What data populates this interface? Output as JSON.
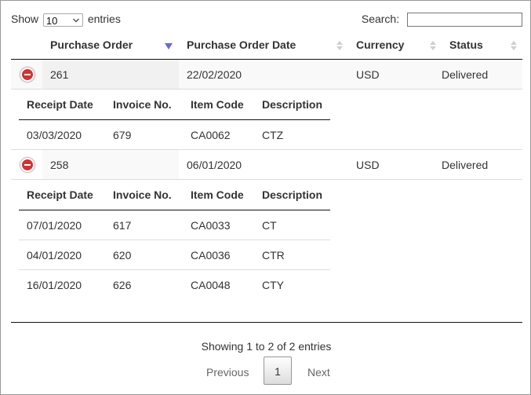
{
  "length": {
    "label_before": "Show",
    "value": "10",
    "label_after": "entries"
  },
  "search": {
    "label": "Search:",
    "value": ""
  },
  "columns": [
    "Purchase Order",
    "Purchase Order Date",
    "Currency",
    "Status"
  ],
  "orders": [
    {
      "po": "261",
      "date": "22/02/2020",
      "currency": "USD",
      "status": "Delivered",
      "detail_columns": [
        "Receipt Date",
        "Invoice No.",
        "Item Code",
        "Description"
      ],
      "details": [
        [
          "03/03/2020",
          "679",
          "CA0062",
          "CTZ"
        ]
      ]
    },
    {
      "po": "258",
      "date": "06/01/2020",
      "currency": "USD",
      "status": "Delivered",
      "detail_columns": [
        "Receipt Date",
        "Invoice No.",
        "Item Code",
        "Description"
      ],
      "details": [
        [
          "07/01/2020",
          "617",
          "CA0033",
          "CT"
        ],
        [
          "04/01/2020",
          "620",
          "CA0036",
          "CTR"
        ],
        [
          "16/01/2020",
          "626",
          "CA0048",
          "CTY"
        ]
      ]
    }
  ],
  "info": "Showing 1 to 2 of 2 entries",
  "pagination": {
    "previous": "Previous",
    "current": "1",
    "next": "Next"
  },
  "colors": {
    "sort_active": "#6a6ad6",
    "sort_inactive": "#cfcfcf",
    "control_red": "#d33333"
  }
}
